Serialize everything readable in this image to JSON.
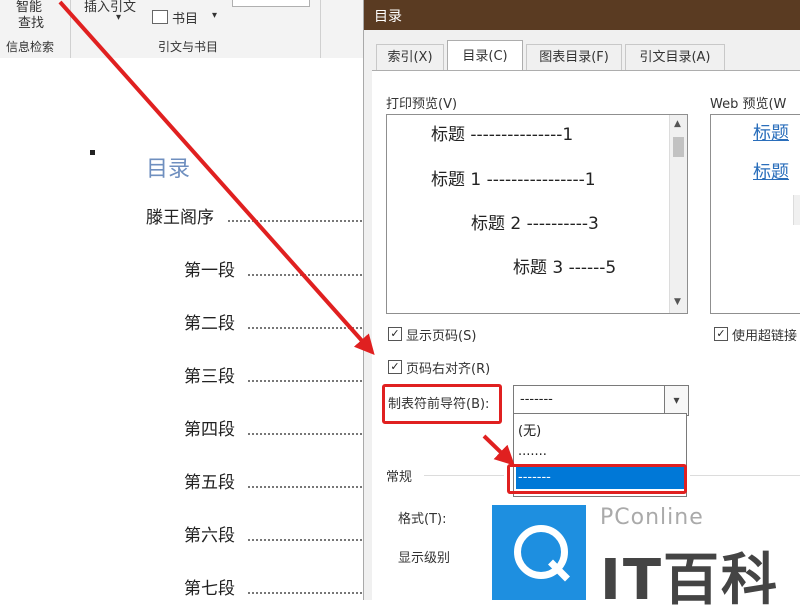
{
  "ribbon": {
    "smart_lookup_line1": "智能",
    "smart_lookup_line2": "查找",
    "insights_group": "信息检索",
    "insert_citation": "插入引文",
    "bibliography": "书目",
    "citations_group": "引文与书目"
  },
  "document": {
    "toc_heading": "目录",
    "entries": [
      "滕王阁序",
      "第一段",
      "第二段",
      "第三段",
      "第四段",
      "第五段",
      "第六段",
      "第七段"
    ]
  },
  "dialog": {
    "title": "目录",
    "tabs": [
      "索引(X)",
      "目录(C)",
      "图表目录(F)",
      "引文目录(A)"
    ],
    "print_preview_label": "打印预览(V)",
    "print_preview_lines": [
      "标题 ---------------1",
      "标题 1 ----------------1",
      "标题 2 ----------3",
      "标题 3 ------5"
    ],
    "web_preview_label": "Web 预览(W",
    "web_preview_links": [
      "标题",
      "标题"
    ],
    "show_page_numbers": "显示页码(S)",
    "right_align_page_numbers": "页码右对齐(R)",
    "use_hyperlinks": "使用超链接",
    "tab_leader_label": "制表符前导符(B):",
    "tab_leader_value": "-------",
    "tab_leader_options": [
      "(无)",
      ".......",
      "-------"
    ],
    "general_label": "常规",
    "formats_label": "格式(T):",
    "show_levels_label": "显示级别"
  },
  "watermark": {
    "brand_en": "PConline",
    "brand_cn": "IT百科"
  },
  "colors": {
    "titlebar": "#5a3b22",
    "highlight": "#e02020",
    "selection": "#0078d7",
    "link": "#2a6ebb"
  }
}
